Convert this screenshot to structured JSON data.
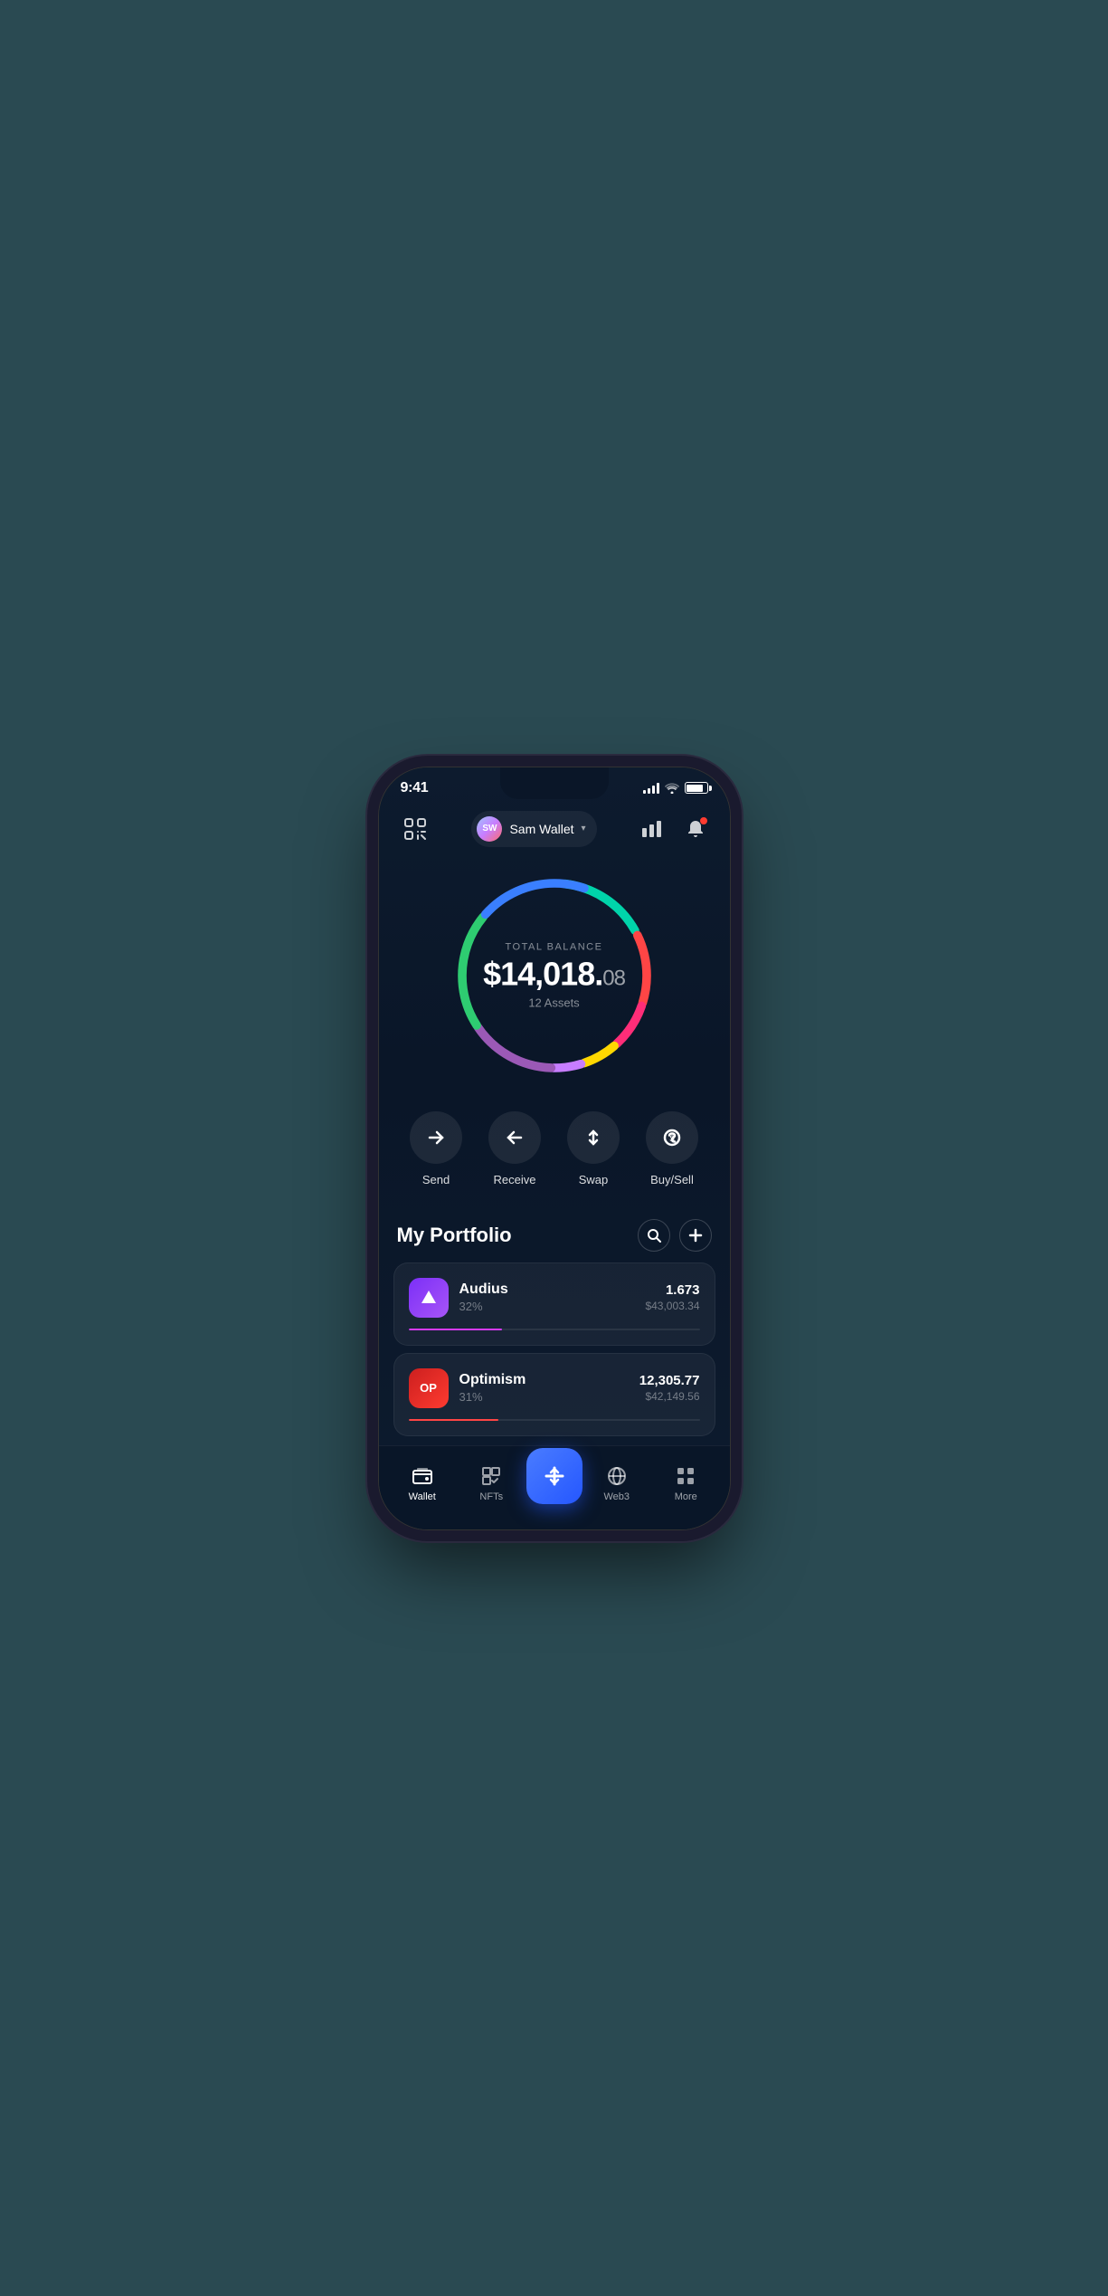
{
  "statusBar": {
    "time": "9:41"
  },
  "header": {
    "walletAvatarInitials": "SW",
    "walletName": "Sam Wallet",
    "dropdownLabel": "▼"
  },
  "balance": {
    "label": "TOTAL BALANCE",
    "mainAmount": "$14,018.",
    "cents": "08",
    "assetsCount": "12 Assets"
  },
  "actions": [
    {
      "id": "send",
      "label": "Send"
    },
    {
      "id": "receive",
      "label": "Receive"
    },
    {
      "id": "swap",
      "label": "Swap"
    },
    {
      "id": "buysell",
      "label": "Buy/Sell"
    }
  ],
  "portfolio": {
    "title": "My Portfolio"
  },
  "assets": [
    {
      "name": "Audius",
      "percent": "32%",
      "amount": "1.673",
      "usd": "$43,003.34",
      "progressWidth": "32",
      "progressColor": "#d63af9",
      "bgColor1": "#7b2ff7",
      "bgColor2": "#a855f7",
      "logoText": "▲"
    },
    {
      "name": "Optimism",
      "percent": "31%",
      "amount": "12,305.77",
      "usd": "$42,149.56",
      "progressWidth": "31",
      "progressColor": "#ff4545",
      "bgColor1": "#cc1f1f",
      "bgColor2": "#ff3b30",
      "logoText": "OP"
    }
  ],
  "nav": [
    {
      "id": "wallet",
      "label": "Wallet",
      "active": true
    },
    {
      "id": "nfts",
      "label": "NFTs",
      "active": false
    },
    {
      "id": "center",
      "label": "",
      "active": false
    },
    {
      "id": "web3",
      "label": "Web3",
      "active": false
    },
    {
      "id": "more",
      "label": "More",
      "active": false
    }
  ]
}
